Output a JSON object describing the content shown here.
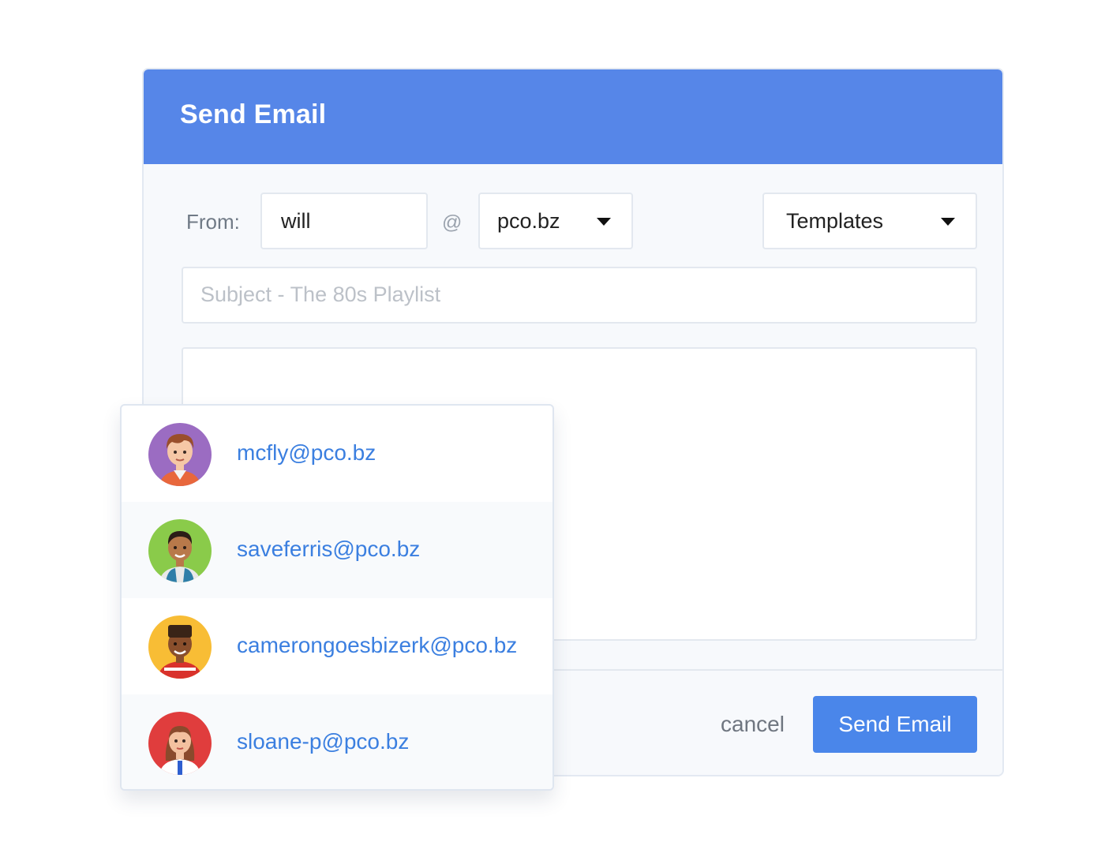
{
  "dialog": {
    "title": "Send Email",
    "from_label": "From:",
    "from_user_value": "will",
    "at_sign": "@",
    "domain_value": "pco.bz",
    "templates_label": "Templates",
    "subject_placeholder": "Subject - The 80s Playlist",
    "cancel_label": "cancel",
    "send_label": "Send Email"
  },
  "suggestions": [
    {
      "email": "mcfly@pco.bz",
      "avatar_bg": "#9b6cc2"
    },
    {
      "email": "saveferris@pco.bz",
      "avatar_bg": "#8acb4a"
    },
    {
      "email": "camerongoesbizerk@pco.bz",
      "avatar_bg": "#f8bd35"
    },
    {
      "email": "sloane-p@pco.bz",
      "avatar_bg": "#e03d3d"
    }
  ],
  "colors": {
    "header": "#5686e8",
    "primary_button": "#4a86ea",
    "link": "#3b7fe0"
  }
}
